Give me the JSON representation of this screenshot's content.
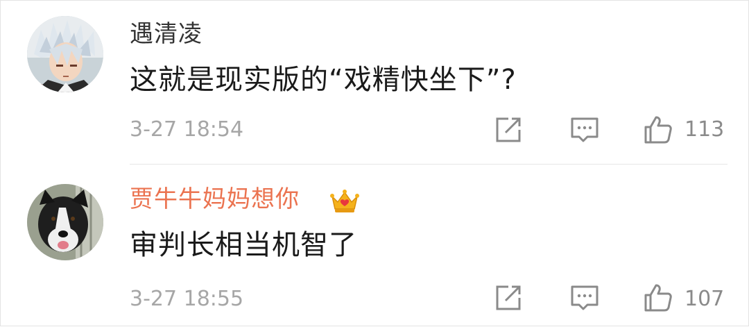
{
  "comments": [
    {
      "username": "遇清凌",
      "username_color": "#333333",
      "avatar": "anime-character-avatar",
      "text": "这就是现实版的“戏精快坐下”?",
      "time": "3-27 18:54",
      "likes": "113",
      "has_vip_badge": false
    },
    {
      "username": "贾牛牛妈妈想你",
      "username_color": "#eb7350",
      "avatar": "dog-avatar",
      "text": "审判长相当机智了",
      "time": "3-27 18:55",
      "likes": "107",
      "has_vip_badge": true
    }
  ],
  "icons": {
    "share": "share-icon",
    "reply": "reply-icon",
    "like": "thumbs-up-icon",
    "vip": "crown-badge-icon"
  },
  "colors": {
    "icon": "#8a8a8a",
    "time": "#a6a6a6",
    "vip_username": "#eb7350",
    "crown": "#f5b21c"
  }
}
